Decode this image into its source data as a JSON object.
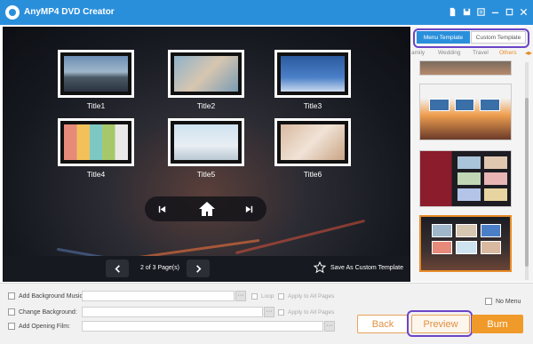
{
  "app": {
    "title": "AnyMP4 DVD Creator"
  },
  "window_controls": [
    "doc-icon",
    "save-icon",
    "menu-icon",
    "minimize-icon",
    "restore-icon",
    "close-icon"
  ],
  "preview": {
    "titles": [
      "Title1",
      "Title2",
      "Title3",
      "Title4",
      "Title5",
      "Title6"
    ],
    "page_indicator": "2 of 3 Page(s)",
    "save_custom_label": "Save As Custom Template"
  },
  "right_panel": {
    "tabs": [
      "Menu Template",
      "Custom Template"
    ],
    "active_tab": "Menu Template",
    "categories": [
      "amily",
      "Wedding",
      "Travel",
      "Others"
    ],
    "active_category": "Others",
    "selected_template_index": 3
  },
  "bottom": {
    "add_bg_music_label": "Add Background Music:",
    "change_bg_label": "Change Background:",
    "add_opening_film_label": "Add Opening Film:",
    "loop_label": "Loop",
    "apply_all_label": "Apply to All Pages",
    "apply_all_label2": "Apply to All Pages",
    "no_menu_label": "No Menu",
    "browse_label": "···",
    "back_label": "Back",
    "preview_label": "Preview",
    "burn_label": "Burn"
  },
  "colors": {
    "titlebar": "#2a8fdb",
    "accent": "#f09a2a",
    "highlight": "#6b44c8"
  }
}
